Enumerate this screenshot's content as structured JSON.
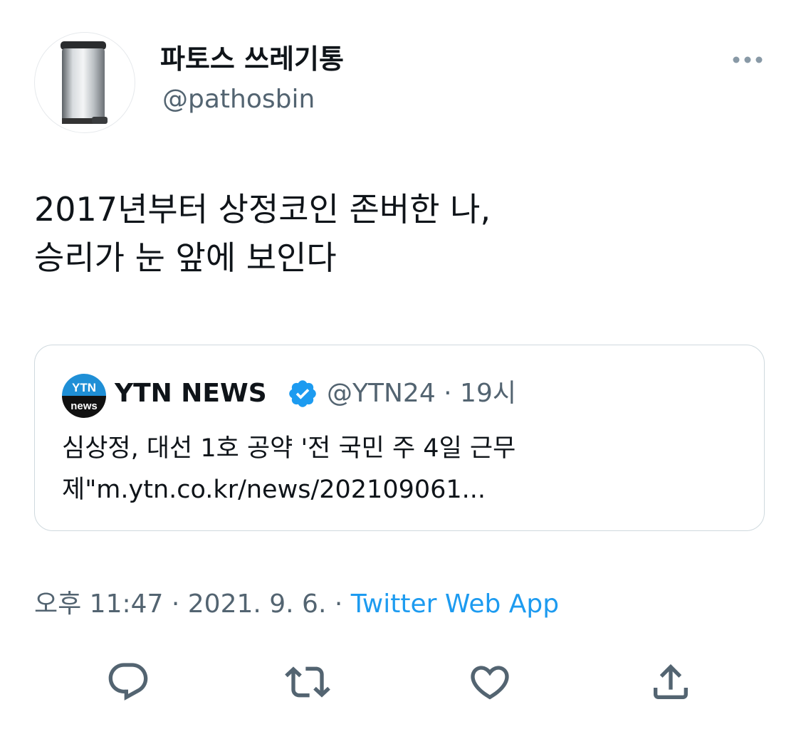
{
  "author": {
    "display_name": "파토스 쓰레기통",
    "handle": "@pathosbin",
    "avatar_icon": "trash-can-icon"
  },
  "more_icon": "more-options-icon",
  "tweet": {
    "lines": [
      "2017년부터 상정코인 존버한 나,",
      "승리가 눈 앞에 보인다"
    ]
  },
  "quote": {
    "logo_top_text": "YTN",
    "logo_bottom_text": "news",
    "display_name": "YTN NEWS",
    "verified_icon": "verified-badge-icon",
    "meta": "@YTN24 · 19시",
    "lines": [
      "심상정, 대선 1호 공약 '전 국민 주 4일 근무",
      "제\"m.ytn.co.kr/news/202109061..."
    ]
  },
  "meta": {
    "time_date": "오후 11:47 · 2021. 9. 6. · ",
    "source": "Twitter Web App"
  },
  "actions": [
    "reply-icon",
    "retweet-icon",
    "like-icon",
    "share-icon"
  ],
  "colors": {
    "accent": "#1d9bf0",
    "secondary_text": "#536471",
    "border": "#cfd9de",
    "ytn_blue": "#1f8fd6"
  }
}
